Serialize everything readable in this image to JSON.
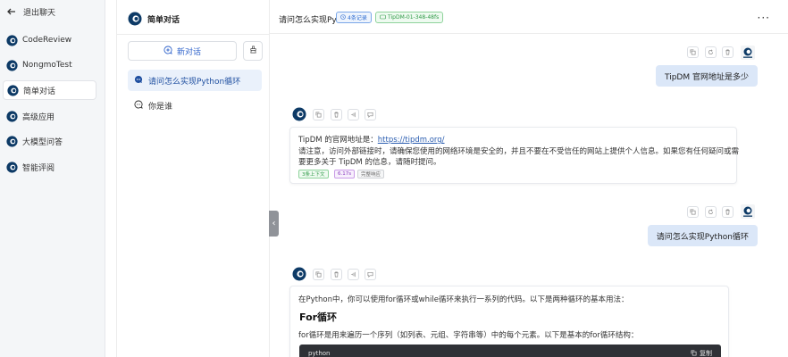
{
  "nav": {
    "back_label": "退出聊天",
    "items": [
      {
        "label": "CodeReview"
      },
      {
        "label": "NongmoTest"
      },
      {
        "label": "简单对话"
      },
      {
        "label": "高级应用"
      },
      {
        "label": "大模型问答"
      },
      {
        "label": "智能评阅"
      }
    ],
    "active_index": 2
  },
  "conversations": {
    "header": "简单对话",
    "new_label": "新对话",
    "items": [
      {
        "label": "请问怎么实现Python循环"
      },
      {
        "label": "你是谁"
      }
    ]
  },
  "topbar": {
    "title": "请问怎么实现Py",
    "tag_records": "4条记录",
    "tag_model": "TipDM-01-348-48fs"
  },
  "messages": {
    "user1": "TipDM 官网地址是多少",
    "ai1": {
      "line1_prefix": "TipDM 的官网地址是：",
      "line1_link": "https://tipdm.org/",
      "line2": "请注意，访问外部链接时，请确保您使用的网络环境是安全的，并且不要在不受信任的网站上提供个人信息。如果您有任何疑问或需",
      "line3": "要更多关于 TipDM 的信息，请随时提问。",
      "chips": [
        "3条上下文",
        "6.17s",
        "完整响应"
      ]
    },
    "user2": "请问怎么实现Python循环",
    "ai2": {
      "intro": "在Python中，你可以使用for循环或while循环来执行一系列的代码。以下是两种循环的基本用法：",
      "heading": "For循环",
      "desc": "for循环是用来遍历一个序列（如列表、元组、字符串等）中的每个元素。以下是基本的for循环结构：",
      "code_lang": "python",
      "copy_label": "复制"
    }
  },
  "colors": {
    "accent": "#2a5db0",
    "user_bubble": "#dbe7f8",
    "nav_bg": "#f4f6f8",
    "active_conv": "#eaf1fb"
  }
}
